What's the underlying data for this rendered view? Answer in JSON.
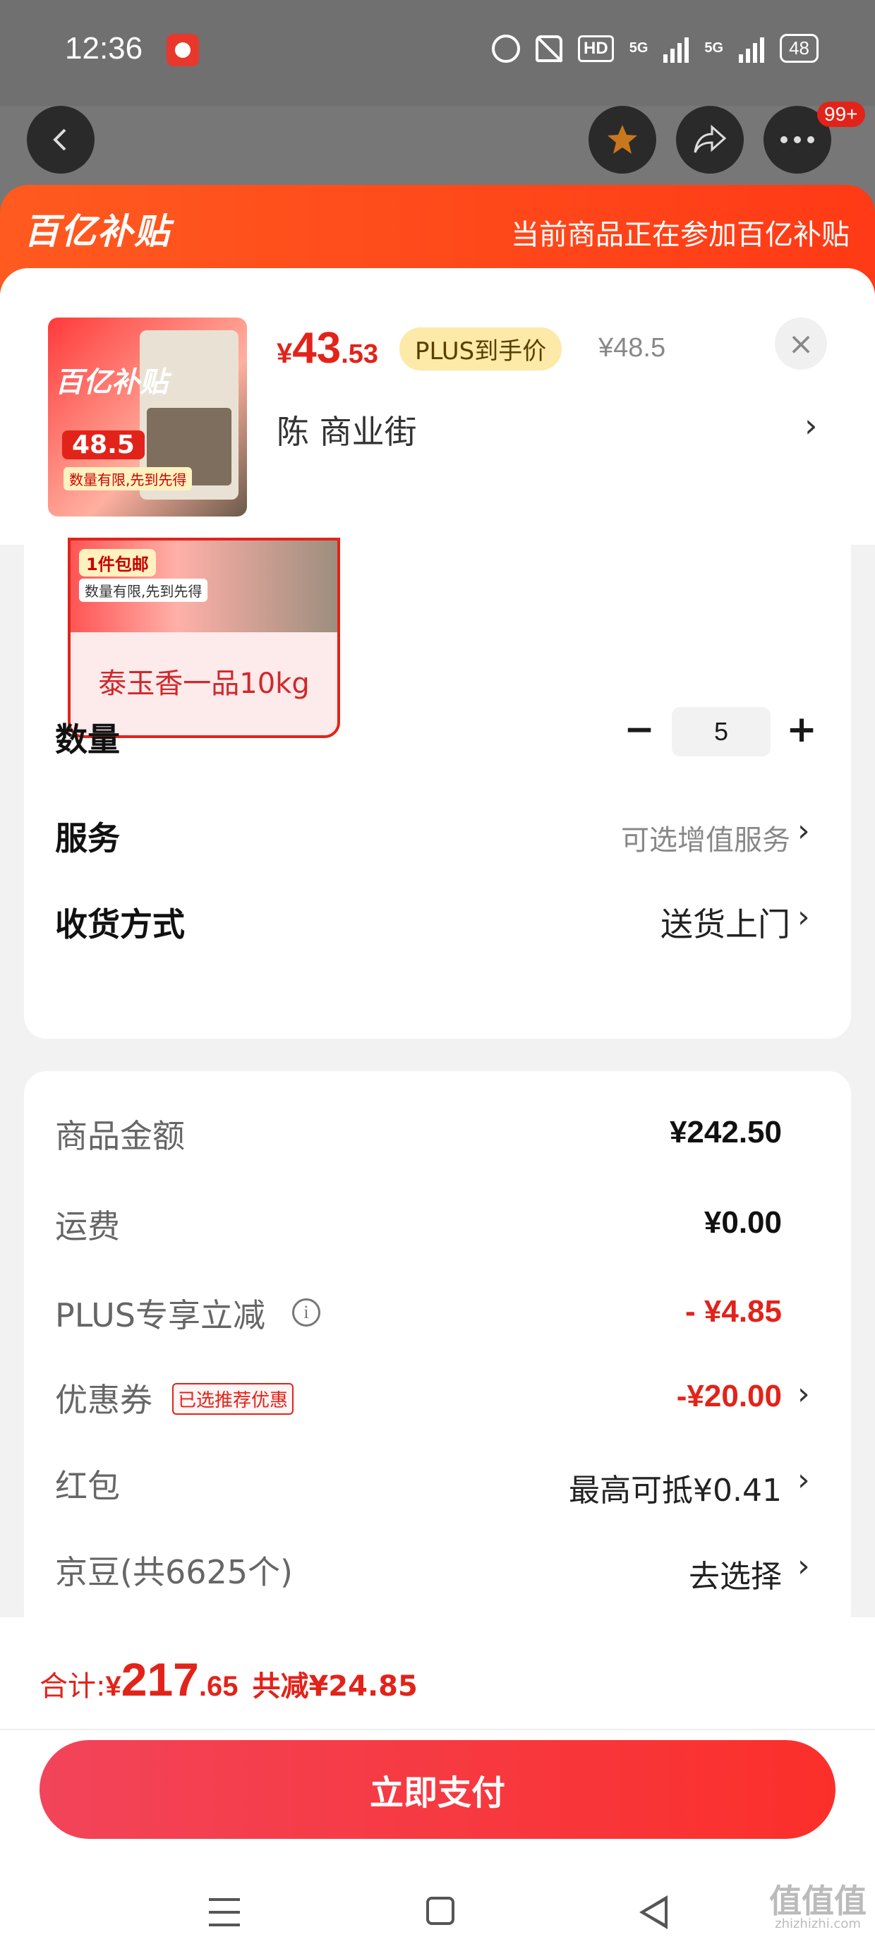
{
  "status_bar": {
    "time": "12:36",
    "hd_label": "HD",
    "battery": "48",
    "signal1": "5G",
    "signal2": "5G"
  },
  "top_nav": {
    "more_badge": "99+"
  },
  "banner": {
    "logo_text": "百亿补贴",
    "message": "当前商品正在参加百亿补贴"
  },
  "product": {
    "thumb_badge": "百亿补贴",
    "thumb_price": "48.5",
    "thumb_shipping": "数量有限,先到先得",
    "price_currency": "¥",
    "price_integer": "43",
    "price_decimal": ".53",
    "plus_tag": "PLUS到手价",
    "original_price": "¥48.5",
    "address": "陈  商业街"
  },
  "variant": {
    "badge": "1件包邮",
    "note": "数量有限,先到先得",
    "label": "泰玉香一品10kg"
  },
  "options": {
    "quantity_label": "数量",
    "quantity_value": "5",
    "service_label": "服务",
    "service_value": "可选增值服务",
    "delivery_label": "收货方式",
    "delivery_value": "送货上门"
  },
  "price_detail": {
    "goods_label": "商品金额",
    "goods_value": "¥242.50",
    "shipping_label": "运费",
    "shipping_value": "¥0.00",
    "plus_label": "PLUS专享立减",
    "plus_value": "- ¥4.85",
    "coupon_label": "优惠券",
    "coupon_tag": "已选推荐优惠",
    "coupon_value": "-¥20.00",
    "redpacket_label": "红包",
    "redpacket_value": "最高可抵¥0.41",
    "jingdou_label": "京豆(共6625个)",
    "jingdou_value": "去选择"
  },
  "footer": {
    "total_label": "合计: ",
    "total_currency": "¥",
    "total_integer": "217",
    "total_decimal": ".65",
    "total_discount": "共减¥24.85",
    "pay_button": "立即支付"
  },
  "watermark": {
    "text": "值值值",
    "url": "zhizhizhi.com"
  },
  "colors": {
    "accent": "#e2231a",
    "banner": "#ff4a1a",
    "plus_tag_bg": "#fde9a8"
  }
}
